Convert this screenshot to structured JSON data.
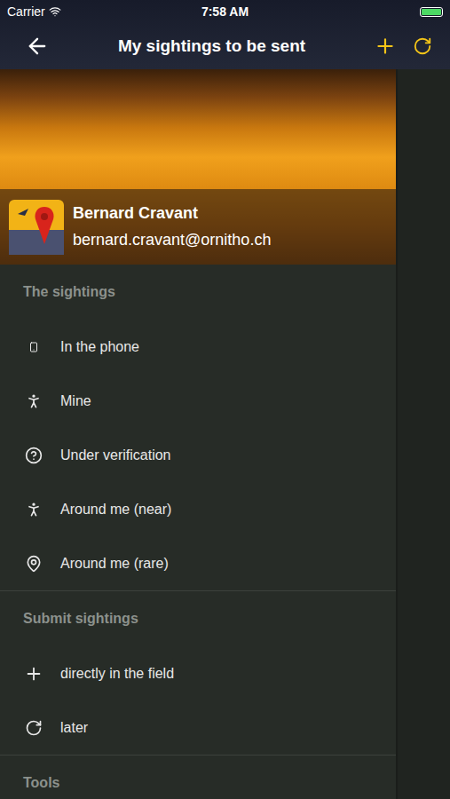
{
  "status_bar": {
    "carrier": "Carrier",
    "time": "7:58 AM"
  },
  "nav": {
    "title": "My sightings to be sent"
  },
  "profile": {
    "name": "Bernard Cravant",
    "email": "bernard.cravant@ornitho.ch"
  },
  "sections": [
    {
      "title": "The sightings",
      "items": [
        {
          "label": "In the phone"
        },
        {
          "label": "Mine"
        },
        {
          "label": "Under verification"
        },
        {
          "label": "Around me (near)"
        },
        {
          "label": "Around me (rare)"
        }
      ]
    },
    {
      "title": "Submit sightings",
      "items": [
        {
          "label": "directly in the field"
        },
        {
          "label": "later"
        }
      ]
    },
    {
      "title": "Tools",
      "items": []
    }
  ]
}
